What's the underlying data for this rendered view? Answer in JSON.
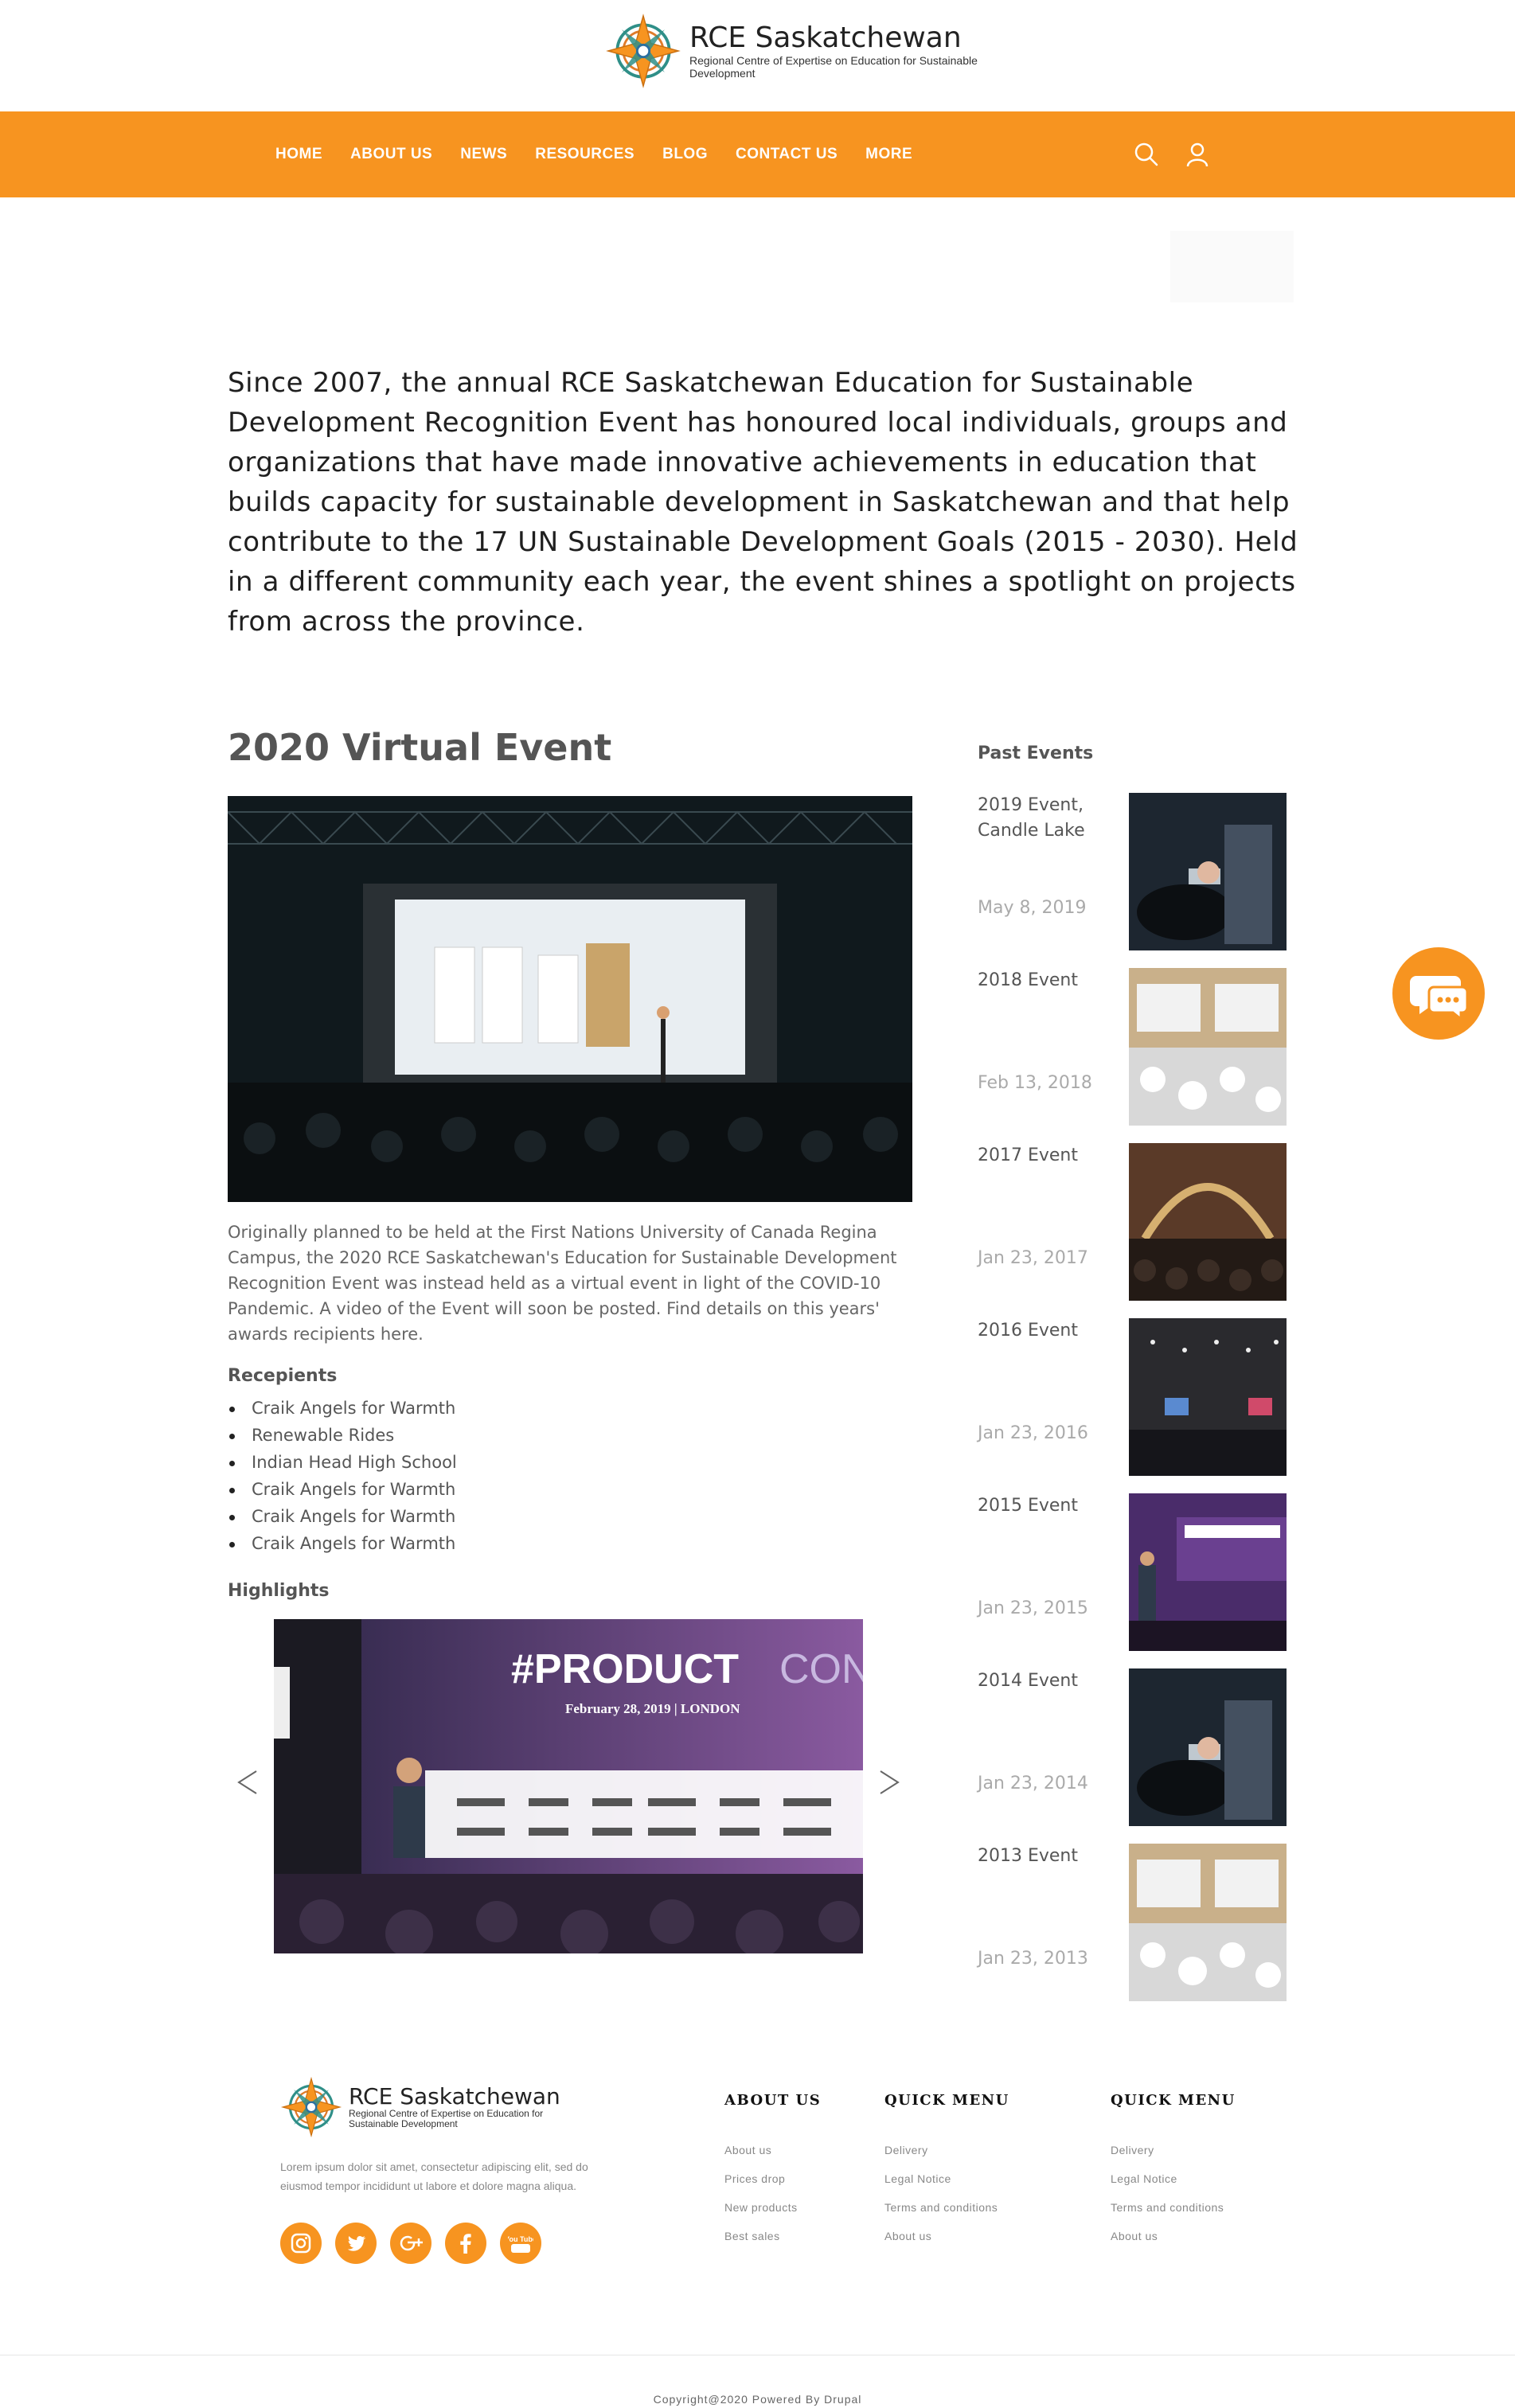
{
  "brand": {
    "title": "RCE Saskatchewan",
    "subtitle": "Regional Centre of Expertise on Education for Sustainable Development",
    "accent_color": "#f79420"
  },
  "nav": {
    "items": [
      "HOME",
      "ABOUT US",
      "NEWS",
      "RESOURCES",
      "BLOG",
      "CONTACT US",
      "MORE"
    ],
    "icons": [
      "search-icon",
      "user-icon"
    ]
  },
  "intro": "Since 2007, the annual RCE Saskatchewan Education for Sustainable Development Recognition Event has honoured local individuals, groups and organizations that have made innovative achievements in education that builds capacity for sustainable development in Saskatchewan and that help contribute to the 17 UN Sustainable Development Goals (2015 - 2030). Held in a different community each year, the event shines a spotlight on projects from across the province.",
  "main": {
    "title": "2020 Virtual Event",
    "description": "Originally planned to be held at the First Nations University of Canada Regina Campus, the 2020 RCE Saskatchewan's Education for Sustainable Development Recognition Event was instead held as a virtual event in light of the COVID-10 Pandemic.  A video of the Event will soon be posted.  Find details on this years' awards recipients here.",
    "recipients_heading": "Recepients",
    "recipients": [
      "Craik Angels for Warmth",
      "Renewable Rides",
      "Indian Head High School",
      "Craik Angels for Warmth",
      "Craik Angels for Warmth",
      "Craik Angels for Warmth"
    ],
    "highlights_heading": "Highlights",
    "highlight_slide": {
      "headline_a": "#PRODUCT",
      "headline_b": "CON",
      "date_line": "February 28, 2019  |  LONDON"
    }
  },
  "past_events": {
    "title": "Past Events",
    "items": [
      {
        "name": "2019 Event, Candle Lake",
        "date": "May 8, 2019"
      },
      {
        "name": "2018 Event",
        "date": "Feb 13, 2018"
      },
      {
        "name": "2017 Event",
        "date": "Jan 23, 2017"
      },
      {
        "name": "2016 Event",
        "date": "Jan 23, 2016"
      },
      {
        "name": "2015 Event",
        "date": "Jan 23, 2015"
      },
      {
        "name": "2014 Event",
        "date": "Jan 23, 2014"
      },
      {
        "name": "2013 Event",
        "date": "Jan 23, 2013"
      }
    ]
  },
  "footer": {
    "text": "Lorem ipsum dolor sit amet, consectetur adipiscing elit, sed do eiusmod tempor incididunt ut labore et dolore magna aliqua.",
    "socials": [
      "instagram-icon",
      "twitter-icon",
      "google-plus-icon",
      "facebook-icon",
      "youtube-icon"
    ],
    "youtube_label": "You Tube",
    "columns": [
      {
        "title": "ABOUT US",
        "links": [
          "About us",
          "Prices drop",
          "New products",
          "Best sales"
        ]
      },
      {
        "title": "QUICK MENU",
        "links": [
          "Delivery",
          "Legal Notice",
          "Terms and conditions",
          "About us"
        ]
      },
      {
        "title": "QUICK MENU",
        "links": [
          "Delivery",
          "Legal Notice",
          "Terms and conditions",
          "About us"
        ]
      }
    ],
    "copyright": "Copyright@2020 Powered By Drupal"
  }
}
